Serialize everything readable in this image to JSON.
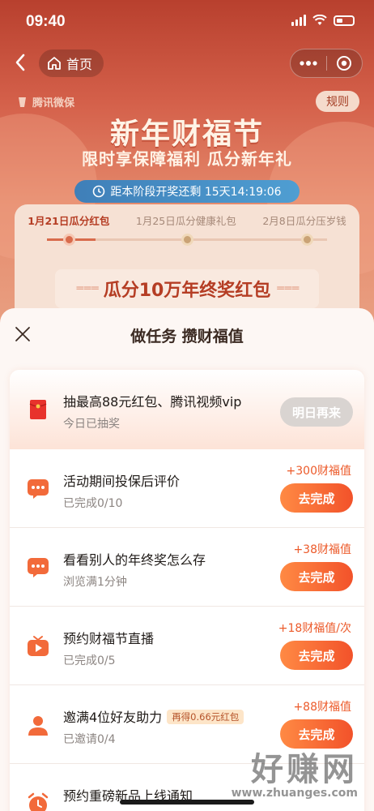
{
  "status_bar": {
    "time": "09:40"
  },
  "nav": {
    "home_label": "首页"
  },
  "header": {
    "logo_text": "腾讯微保",
    "rules_label": "规则",
    "title": "新年财福节",
    "subtitle": "限时享保障福利 瓜分新年礼",
    "countdown": "距本阶段开奖还剩 15天14:19:06"
  },
  "stages": [
    {
      "label": "1月21日瓜分红包"
    },
    {
      "label": "1月25日瓜分健康礼包"
    },
    {
      "label": "2月8日瓜分压岁钱"
    }
  ],
  "banner": {
    "text": "瓜分10万年终奖红包"
  },
  "sheet": {
    "title": "做任务 攒财福值",
    "tasks": [
      {
        "title": "抽最高88元红包、腾讯视频vip",
        "subtitle": "今日已抽奖",
        "button": "明日再来",
        "icon": "red-envelope-icon"
      },
      {
        "title": "活动期间投保后评价",
        "subtitle": "已完成0/10",
        "reward": "+300财福值",
        "button": "去完成",
        "icon": "comment-icon"
      },
      {
        "title": "看看别人的年终奖怎么存",
        "subtitle": "浏览满1分钟",
        "reward": "+38财福值",
        "button": "去完成",
        "icon": "comment-icon"
      },
      {
        "title": "预约财福节直播",
        "subtitle": "已完成0/5",
        "reward": "+18财福值/次",
        "button": "去完成",
        "icon": "tv-play-icon"
      },
      {
        "title": "邀满4位好友助力",
        "badge": "再得0.66元红包",
        "subtitle": "已邀请0/4",
        "reward": "+88财福值",
        "button": "去完成",
        "icon": "user-icon"
      },
      {
        "title": "预约重磅新品上线通知",
        "icon": "alarm-clock-icon"
      }
    ]
  },
  "watermark": {
    "big": "好赚网",
    "small": "www.zhuanges.com"
  },
  "colors": {
    "accent": "#f2522a",
    "brand_red": "#b53d24"
  }
}
